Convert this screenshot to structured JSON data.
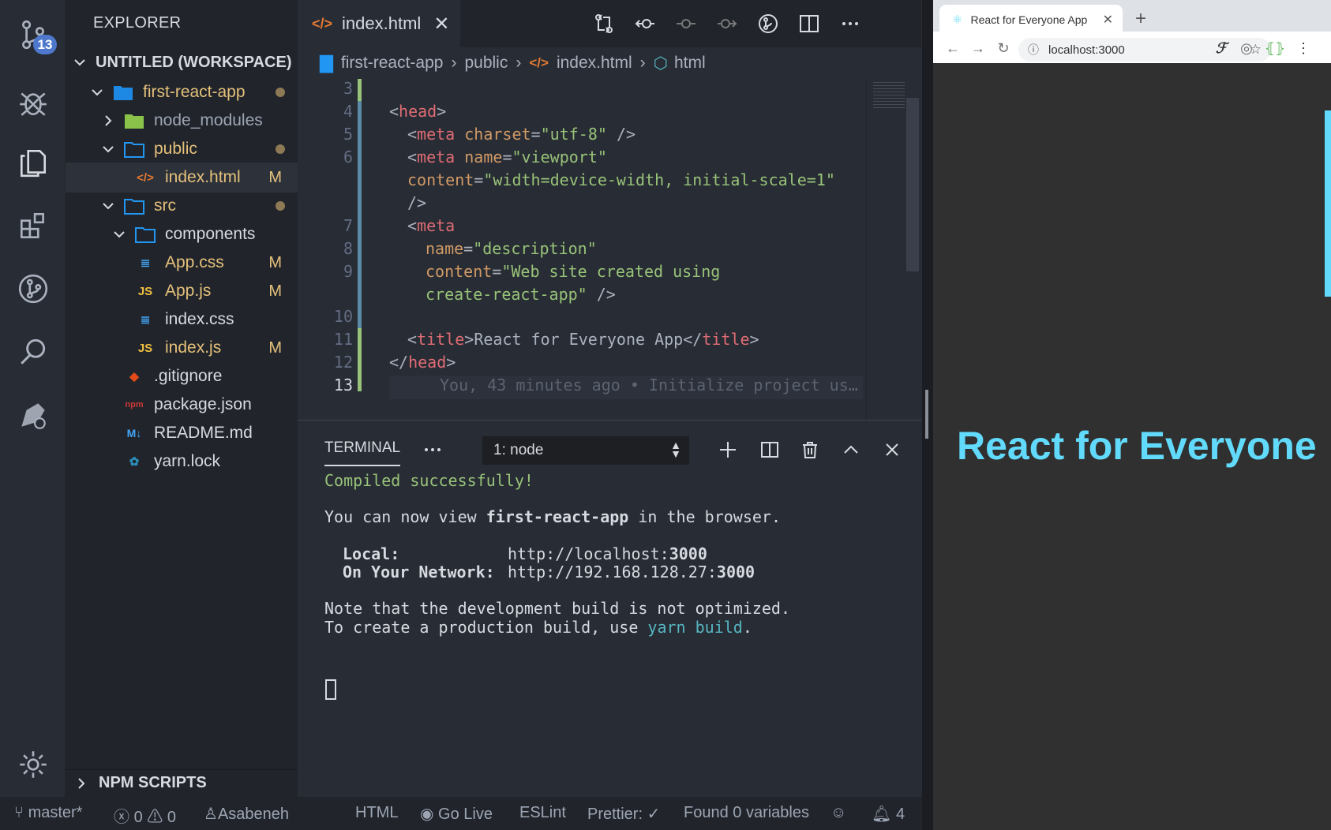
{
  "activity": {
    "scm_badge": "13"
  },
  "sidebar": {
    "title": "EXPLORER",
    "workspace": "UNTITLED (WORKSPACE)",
    "items": [
      {
        "label": "first-react-app",
        "status": ""
      },
      {
        "label": "node_modules",
        "status": ""
      },
      {
        "label": "public",
        "status": ""
      },
      {
        "label": "index.html",
        "status": "M"
      },
      {
        "label": "src",
        "status": ""
      },
      {
        "label": "components",
        "status": ""
      },
      {
        "label": "App.css",
        "status": "M"
      },
      {
        "label": "App.js",
        "status": "M"
      },
      {
        "label": "index.css",
        "status": ""
      },
      {
        "label": "index.js",
        "status": "M"
      },
      {
        "label": ".gitignore",
        "status": ""
      },
      {
        "label": "package.json",
        "status": ""
      },
      {
        "label": "README.md",
        "status": ""
      },
      {
        "label": "yarn.lock",
        "status": ""
      }
    ],
    "npm_scripts": "NPM SCRIPTS"
  },
  "editor": {
    "tab_label": "index.html",
    "breadcrumb": [
      "first-react-app",
      "public",
      "index.html",
      "html"
    ],
    "line_numbers": [
      "3",
      "4",
      "5",
      "6",
      "7",
      "8",
      "9",
      "10",
      "11",
      "12",
      "13"
    ],
    "code": {
      "l4_tag": "head",
      "l5_tag": "meta",
      "l5_attr": "charset",
      "l5_val": "\"utf-8\"",
      "l6_tag": "meta",
      "l6_attr": "name",
      "l6_val": "\"viewport\"",
      "l6b_attr": "content",
      "l6b_val": "\"width=device-width, initial-scale=1\"",
      "l7_tag": "meta",
      "l8_attr": "name",
      "l8_val": "\"description\"",
      "l9_attr": "content",
      "l9_val": "\"Web site created using",
      "l9b_val": "create-react-app\"",
      "l11_tag": "title",
      "l11_text": "React for Everyone App",
      "l12_tag": "head",
      "l13_blame": "You, 43 minutes ago • Initialize project us…"
    }
  },
  "terminal": {
    "tab": "TERMINAL",
    "select": "1: node",
    "lines": {
      "compiled": "Compiled successfully!",
      "view_pre": "You can now view ",
      "view_app": "first-react-app",
      "view_post": " in the browser.",
      "local_label": "Local:",
      "local_url": "http://localhost:",
      "local_port": "3000",
      "net_label": "On Your Network:",
      "net_url": "http://192.168.128.27:",
      "net_port": "3000",
      "note1": "Note that the development build is not optimized.",
      "note2_pre": "To create a production build, use ",
      "note2_cmd": "yarn build",
      "note2_post": "."
    }
  },
  "statusbar": {
    "branch": "master*",
    "errors": "0",
    "warnings": "0",
    "user": "Asabeneh",
    "language": "HTML",
    "golive": "Go Live",
    "eslint": "ESLint",
    "prettier": "Prettier: ✓",
    "variables": "Found 0 variables",
    "notifications": "4"
  },
  "browser": {
    "tab_title": "React for Everyone App",
    "url": "localhost:3000",
    "heading": "React for Everyone"
  },
  "colors": {
    "accent": "#4d78cc",
    "react_blue": "#61dafb"
  }
}
